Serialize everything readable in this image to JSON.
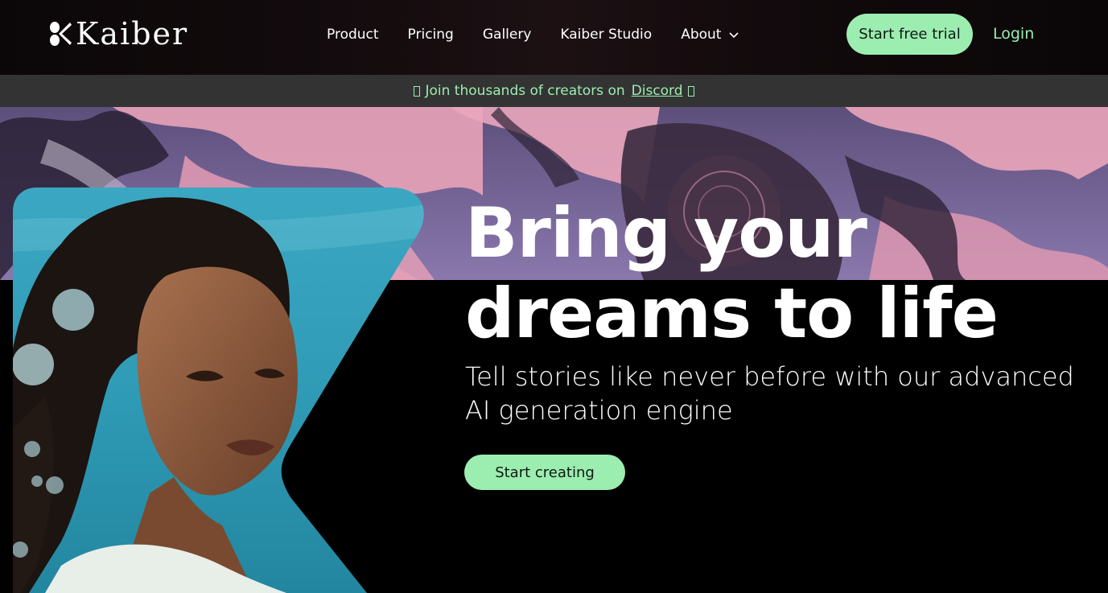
{
  "brand": {
    "logo_text": "Kaiber"
  },
  "nav": {
    "items": [
      {
        "label": "Product"
      },
      {
        "label": "Pricing"
      },
      {
        "label": "Gallery"
      },
      {
        "label": "Kaiber Studio"
      },
      {
        "label": "About",
        "has_dropdown": true
      }
    ]
  },
  "header": {
    "trial_label": "Start free trial",
    "login_label": "Login"
  },
  "banner": {
    "text": "Join thousands of creators on",
    "link_label": "Discord"
  },
  "hero": {
    "title_line1": "Bring your",
    "title_line2": "dreams to life",
    "subtitle": "Tell stories like never before with our advanced AI generation engine",
    "cta_label": "Start creating"
  },
  "colors": {
    "accent": "#9cedb0",
    "banner_bg": "#333333",
    "page_bg": "#000000",
    "header_bg": "#120a0c"
  }
}
